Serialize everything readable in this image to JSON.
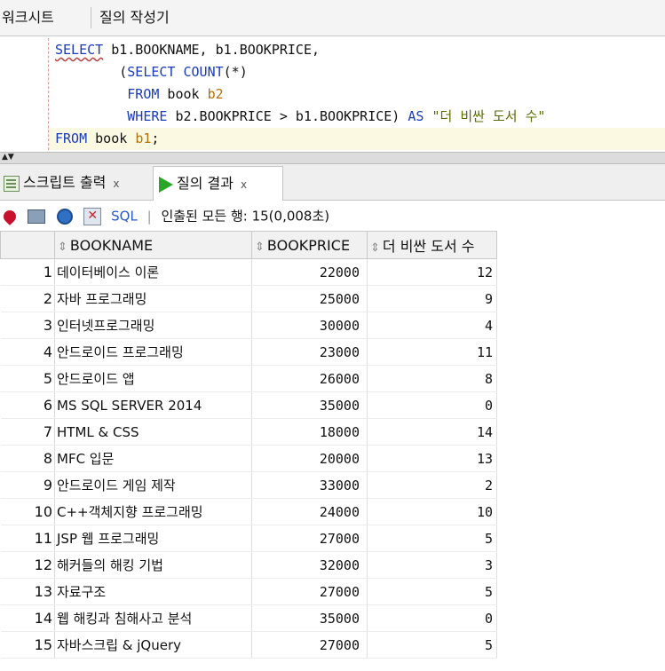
{
  "top_tabs": [
    "워크시트",
    "질의 작성기"
  ],
  "sql_lines": [
    {
      "parts": [
        [
          "kw",
          "SELECT"
        ],
        [
          "t",
          " b1.BOOKNAME, b1.BOOKPRICE,"
        ]
      ]
    },
    {
      "parts": [
        [
          "t",
          "        ("
        ],
        [
          "kw",
          "SELECT COUNT"
        ],
        [
          "t",
          "(*)"
        ]
      ]
    },
    {
      "parts": [
        [
          "t",
          "         "
        ],
        [
          "kw",
          "FROM"
        ],
        [
          "t",
          " book "
        ],
        [
          "num",
          "b2"
        ]
      ]
    },
    {
      "parts": [
        [
          "t",
          "         "
        ],
        [
          "kw",
          "WHERE"
        ],
        [
          "t",
          " b2.BOOKPRICE > b1.BOOKPRICE) "
        ],
        [
          "kw",
          "AS"
        ],
        [
          "t",
          " "
        ],
        [
          "str",
          "\"더 비싼 도서 수\""
        ]
      ]
    },
    {
      "parts": [
        [
          "kw",
          "FROM"
        ],
        [
          "t",
          " book "
        ],
        [
          "num",
          "b1"
        ],
        [
          "t",
          ";"
        ]
      ]
    }
  ],
  "result_tabs": {
    "script_output": "스크립트 출력",
    "query_result": "질의 결과",
    "close": "x"
  },
  "toolbar": {
    "sql_label": "SQL",
    "separator": "|",
    "rows_info": "인출된 모든 행: 15(0,008초)"
  },
  "table": {
    "columns": [
      "BOOKNAME",
      "BOOKPRICE",
      "더 비싼 도서 수"
    ],
    "rows": [
      {
        "n": "1",
        "name": "데이터베이스 이론",
        "price": "22000",
        "cnt": "12"
      },
      {
        "n": "2",
        "name": "자바 프로그래밍",
        "price": "25000",
        "cnt": "9"
      },
      {
        "n": "3",
        "name": "인터넷프로그래밍",
        "price": "30000",
        "cnt": "4"
      },
      {
        "n": "4",
        "name": "안드로이드 프로그래밍",
        "price": "23000",
        "cnt": "11"
      },
      {
        "n": "5",
        "name": "안드로이드 앱",
        "price": "26000",
        "cnt": "8"
      },
      {
        "n": "6",
        "name": "MS SQL SERVER 2014",
        "price": "35000",
        "cnt": "0"
      },
      {
        "n": "7",
        "name": "HTML & CSS",
        "price": "18000",
        "cnt": "14"
      },
      {
        "n": "8",
        "name": "MFC 입문",
        "price": "20000",
        "cnt": "13"
      },
      {
        "n": "9",
        "name": "안드로이드 게임 제작",
        "price": "33000",
        "cnt": "2"
      },
      {
        "n": "10",
        "name": "C++객체지향 프로그래밍",
        "price": "24000",
        "cnt": "10"
      },
      {
        "n": "11",
        "name": "JSP 웹 프로그래밍",
        "price": "27000",
        "cnt": "5"
      },
      {
        "n": "12",
        "name": "해커들의 해킹 기법",
        "price": "32000",
        "cnt": "3"
      },
      {
        "n": "13",
        "name": "자료구조",
        "price": "27000",
        "cnt": "5"
      },
      {
        "n": "14",
        "name": "웹 해킹과 침해사고 분석",
        "price": "35000",
        "cnt": "0"
      },
      {
        "n": "15",
        "name": "자바스크립 & jQuery",
        "price": "27000",
        "cnt": "5"
      }
    ]
  }
}
